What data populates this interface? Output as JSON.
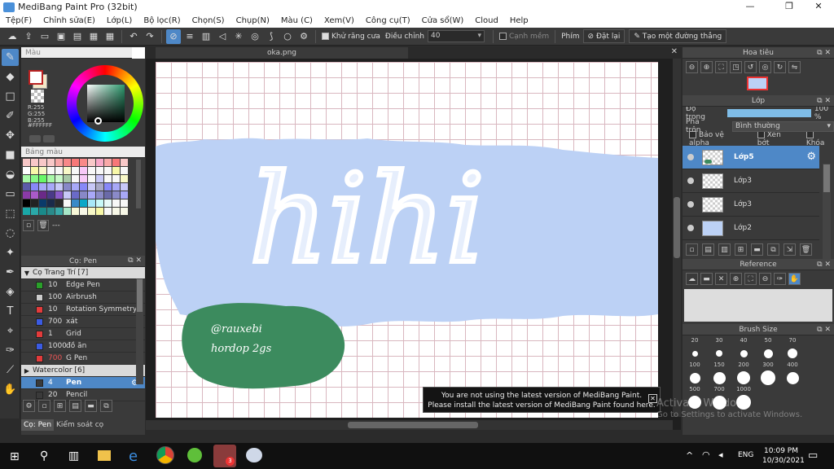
{
  "window": {
    "title": "MediBang Paint Pro (32bit)",
    "controls": {
      "minimize": "—",
      "maximize": "❐",
      "close": "✕"
    }
  },
  "menu": [
    "Tệp(F)",
    "Chỉnh sửa(E)",
    "Lớp(L)",
    "Bộ lọc(R)",
    "Chọn(S)",
    "Chụp(N)",
    "Màu (C)",
    "Xem(V)",
    "Công cụ(T)",
    "Cửa sổ(W)",
    "Cloud",
    "Help"
  ],
  "toolbar": {
    "antialias_label": "Khử răng cưa",
    "adjust_label": "Điều chỉnh",
    "adjust_value": "40",
    "soft_edge_label": "Cạnh mềm",
    "key_label": "Phím",
    "reset_label": "Đặt lại",
    "straight_line_label": "Tạo một đường thẳng"
  },
  "color_panel": {
    "title": "Màu",
    "rgb_lines": [
      "R:255",
      "G:255",
      "B:255"
    ],
    "hex": "#FFFFFF",
    "swatches_title": "Bảng màu",
    "swatch_dash": "---"
  },
  "brush_panel": {
    "title": "Cọ: Pen",
    "items": [
      {
        "type": "group",
        "label": "Cọ Trang Trí [7]",
        "arrow": "▼"
      },
      {
        "size": "10",
        "name": "Edge Pen",
        "color": "#2aa02a"
      },
      {
        "size": "100",
        "name": "Airbrush",
        "color": "#cccccc"
      },
      {
        "size": "10",
        "name": "Rotation Symmetry",
        "color": "#e23b3b"
      },
      {
        "size": "700",
        "name": "xát",
        "color": "#3b5be2"
      },
      {
        "size": "1",
        "name": "Grid",
        "color": "#e23b3b"
      },
      {
        "size": "1000",
        "name": "đồ ăn",
        "color": "#3b5be2"
      },
      {
        "size": "700",
        "name": "G Pen",
        "color": "#e23b3b",
        "red_num": true
      },
      {
        "type": "group",
        "label": "Watercolor [6]",
        "arrow": "▶"
      },
      {
        "size": "4",
        "name": "Pen",
        "color": "#3a3a3a",
        "selected": true
      },
      {
        "size": "20",
        "name": "Pencil",
        "color": "#3a3a3a"
      }
    ],
    "tabs": [
      "Cọ: Pen",
      "Kiểm soát cọ"
    ]
  },
  "document": {
    "tab": "oka.png",
    "close": "✕"
  },
  "canvas_text": {
    "title": "hihi",
    "signature_lines": [
      "@rauxebi",
      "hordop 2gs"
    ]
  },
  "toast": {
    "line1": "You are not using the latest version of MediBang Paint.",
    "line2": "Please install the latest version of MediBang Paint found here.",
    "close": "✕"
  },
  "watermark": {
    "line1": "Activate Windows",
    "line2": "Go to Settings to activate Windows."
  },
  "navigator": {
    "title": "Hoa tiêu"
  },
  "layer_panel": {
    "title": "Lớp",
    "opacity_label": "Độ trong",
    "opacity_value": "100 %",
    "opacity": 1.0,
    "blend_label": "Pha trộn",
    "blend_value": "Bình thường",
    "protect_alpha": "Bảo vệ alpha",
    "clipping": "Xén bớt",
    "lock": "Khóa",
    "layers": [
      {
        "name": "Lớp5",
        "selected": true,
        "thumb": "green"
      },
      {
        "name": "Lớp3",
        "selected": false,
        "thumb": "transparent"
      },
      {
        "name": "Lớp3",
        "selected": false,
        "thumb": "transparent"
      },
      {
        "name": "Lớp2",
        "selected": false,
        "thumb": "blue"
      }
    ]
  },
  "reference": {
    "title": "Reference"
  },
  "brush_size": {
    "title": "Brush Size",
    "sizes": [
      "20",
      "30",
      "40",
      "50",
      "70",
      "100",
      "150",
      "200",
      "300",
      "400",
      "500",
      "700",
      "1000"
    ]
  },
  "taskbar": {
    "time": "10:09 PM",
    "date": "10/30/2021",
    "lang": "ENG",
    "badge": "3"
  },
  "colors": {
    "accent": "#4e88c7",
    "canvas_blue": "#bcd1f5",
    "sign_green": "#3c8b5e",
    "grid_line": "#d9b7bf",
    "panel_bg": "#3a3a3a"
  }
}
